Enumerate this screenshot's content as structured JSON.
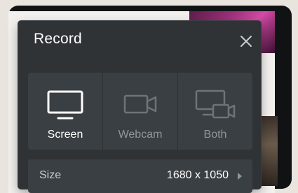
{
  "dialog": {
    "title": "Record",
    "close_icon": "close-icon"
  },
  "sources": [
    {
      "label": "Screen",
      "icon": "monitor-icon",
      "selected": true
    },
    {
      "label": "Webcam",
      "icon": "camera-icon",
      "selected": false
    },
    {
      "label": "Both",
      "icon": "monitor-camera-icon",
      "selected": false
    }
  ],
  "size": {
    "label": "Size",
    "value": "1680 x 1050",
    "icon": "chevron-right-icon"
  },
  "colors": {
    "panel": "#2f3336",
    "tile": "#3a3f43",
    "active_text": "#ffffff",
    "inactive_text": "#8f969c"
  }
}
